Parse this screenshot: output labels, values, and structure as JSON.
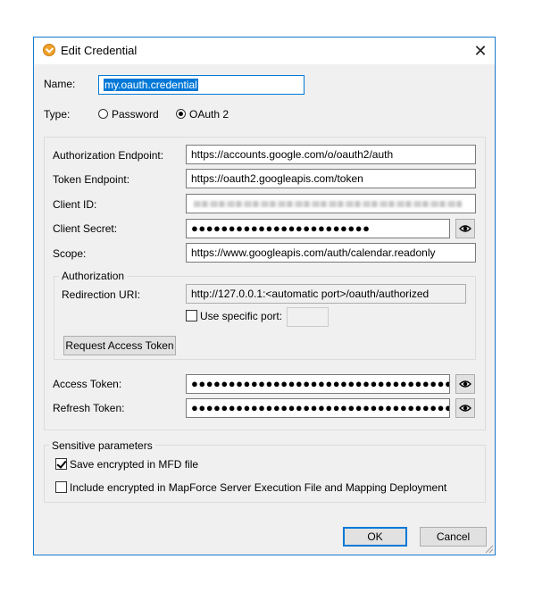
{
  "window": {
    "title": "Edit Credential",
    "close_glyph": "✕"
  },
  "name": {
    "label": "Name:",
    "value": "my.oauth.credential"
  },
  "type": {
    "label": "Type:",
    "options": [
      {
        "label": "Password",
        "selected": false
      },
      {
        "label": "OAuth 2",
        "selected": true
      }
    ]
  },
  "oauth": {
    "auth_endpoint": {
      "label": "Authorization Endpoint:",
      "value": "https://accounts.google.com/o/oauth2/auth"
    },
    "token_endpoint": {
      "label": "Token Endpoint:",
      "value": "https://oauth2.googleapis.com/token"
    },
    "client_id": {
      "label": "Client ID:"
    },
    "client_secret": {
      "label": "Client Secret:",
      "value": "●●●●●●●●●●●●●●●●●●●●●●●●"
    },
    "scope": {
      "label": "Scope:",
      "value": "https://www.googleapis.com/auth/calendar.readonly"
    }
  },
  "authorization": {
    "group_title": "Authorization",
    "redirect_label": "Redirection URI:",
    "redirect_value": "http://127.0.0.1:<automatic port>/oauth/authorized",
    "specific_port_label": "Use specific port:",
    "specific_port_checked": false,
    "request_button": "Request Access Token"
  },
  "tokens": {
    "access": {
      "label": "Access Token:",
      "value": "●●●●●●●●●●●●●●●●●●●●●●●●●●●●●●●●●●●●●●●●●●●●●●●●●●"
    },
    "refresh": {
      "label": "Refresh Token:",
      "value": "●●●●●●●●●●●●●●●●●●●●●●●●●●●●●●●●●●●●●●●●●●●●●●●●●●"
    }
  },
  "sensitive": {
    "group_title": "Sensitive parameters",
    "save_encrypted_label": "Save encrypted in MFD file",
    "save_encrypted_checked": true,
    "include_encrypted_label": "Include encrypted in MapForce Server Execution File and Mapping Deployment",
    "include_encrypted_checked": false
  },
  "buttons": {
    "ok": "OK",
    "cancel": "Cancel"
  },
  "icons": {
    "app": "mapforce-app-icon",
    "eye": "eye-icon",
    "close": "close-icon"
  },
  "colors": {
    "accent": "#0078d7",
    "dialog_bg": "#f0f0f0",
    "border": "#1979ca"
  }
}
